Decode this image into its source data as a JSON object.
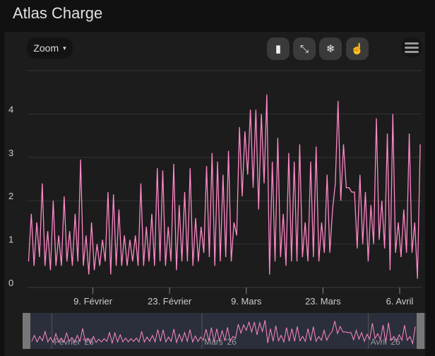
{
  "header": {
    "title": "Atlas Charge"
  },
  "toolbar": {
    "zoom_label": "Zoom",
    "zoom_caret": "▾",
    "buttons": [
      {
        "name": "measure-icon",
        "glyph": "▮"
      },
      {
        "name": "collapse-icon",
        "glyph": "⤡"
      },
      {
        "name": "snowflake-icon",
        "glyph": "❄"
      },
      {
        "name": "hand-pointer-icon",
        "glyph": "☝"
      }
    ],
    "menu_icon": "hamburger-menu-icon"
  },
  "colors": {
    "series": "#ff88c8",
    "navigator_bg": "#2b2f3b",
    "grid": "#333333"
  },
  "chart_data": {
    "type": "line",
    "title": "Atlas Charge",
    "x_start": "2026-01-28",
    "x_unit": "day",
    "x_range_days": [
      0,
      72
    ],
    "ylim": [
      0,
      5
    ],
    "y_ticks": [
      "0",
      "1",
      "2",
      "3",
      "4"
    ],
    "x_ticks": [
      {
        "day": 12,
        "label": "9. Février"
      },
      {
        "day": 26,
        "label": "23. Février"
      },
      {
        "day": 40,
        "label": "9. Mars"
      },
      {
        "day": 54,
        "label": "23. Mars"
      },
      {
        "day": 68,
        "label": "6. Avril"
      }
    ],
    "navigator_ticks": [
      {
        "day": 4,
        "label": "Février '26"
      },
      {
        "day": 32,
        "label": "Mars '26"
      },
      {
        "day": 63,
        "label": "Avril '26"
      }
    ],
    "series": [
      {
        "name": "Charge",
        "daily_low_high": [
          [
            0.6,
            1.7
          ],
          [
            0.5,
            1.5
          ],
          [
            0.7,
            2.4
          ],
          [
            0.5,
            1.3
          ],
          [
            0.4,
            2.0
          ],
          [
            0.5,
            1.2
          ],
          [
            0.5,
            2.1
          ],
          [
            0.6,
            1.3
          ],
          [
            0.5,
            1.7
          ],
          [
            0.6,
            2.95
          ],
          [
            0.5,
            1.2
          ],
          [
            0.3,
            1.5
          ],
          [
            0.4,
            1.0
          ],
          [
            0.5,
            1.1
          ],
          [
            0.6,
            2.2
          ],
          [
            0.3,
            2.15
          ],
          [
            0.5,
            1.8
          ],
          [
            0.5,
            1.2
          ],
          [
            0.5,
            1.1
          ],
          [
            0.6,
            1.2
          ],
          [
            0.5,
            2.4
          ],
          [
            0.5,
            1.4
          ],
          [
            0.6,
            1.7
          ],
          [
            0.5,
            2.75
          ],
          [
            0.6,
            2.7
          ],
          [
            0.5,
            1.4
          ],
          [
            0.6,
            2.85
          ],
          [
            0.4,
            1.9
          ],
          [
            0.6,
            2.2
          ],
          [
            0.6,
            2.75
          ],
          [
            0.5,
            1.6
          ],
          [
            0.6,
            1.4
          ],
          [
            0.8,
            2.8
          ],
          [
            0.7,
            3.1
          ],
          [
            0.5,
            2.9
          ],
          [
            0.6,
            2.6
          ],
          [
            0.7,
            3.15
          ],
          [
            0.6,
            1.5
          ],
          [
            1.2,
            3.7
          ],
          [
            2.1,
            3.6
          ],
          [
            2.6,
            4.1
          ],
          [
            2.3,
            4.1
          ],
          [
            1.8,
            4.0
          ],
          [
            2.4,
            4.45
          ],
          [
            0.3,
            2.9
          ],
          [
            0.6,
            3.45
          ],
          [
            0.7,
            1.7
          ],
          [
            0.5,
            3.1
          ],
          [
            0.6,
            2.9
          ],
          [
            0.6,
            3.3
          ],
          [
            0.7,
            1.5
          ],
          [
            0.6,
            2.9
          ],
          [
            0.7,
            3.25
          ],
          [
            0.6,
            1.5
          ],
          [
            0.8,
            2.6
          ],
          [
            0.8,
            1.8
          ],
          [
            2.4,
            4.3
          ],
          [
            2.0,
            3.3
          ],
          [
            2.3,
            2.3
          ],
          [
            2.2,
            2.2
          ],
          [
            0.9,
            2.6
          ],
          [
            1.0,
            2.2
          ],
          [
            0.6,
            1.9
          ],
          [
            1.0,
            3.9
          ],
          [
            1.1,
            2.0
          ],
          [
            0.9,
            3.55
          ],
          [
            0.4,
            4.0
          ],
          [
            0.8,
            1.5
          ],
          [
            0.7,
            1.8
          ],
          [
            0.8,
            3.55
          ],
          [
            0.8,
            1.5
          ],
          [
            0.2,
            3.3
          ]
        ]
      }
    ]
  }
}
